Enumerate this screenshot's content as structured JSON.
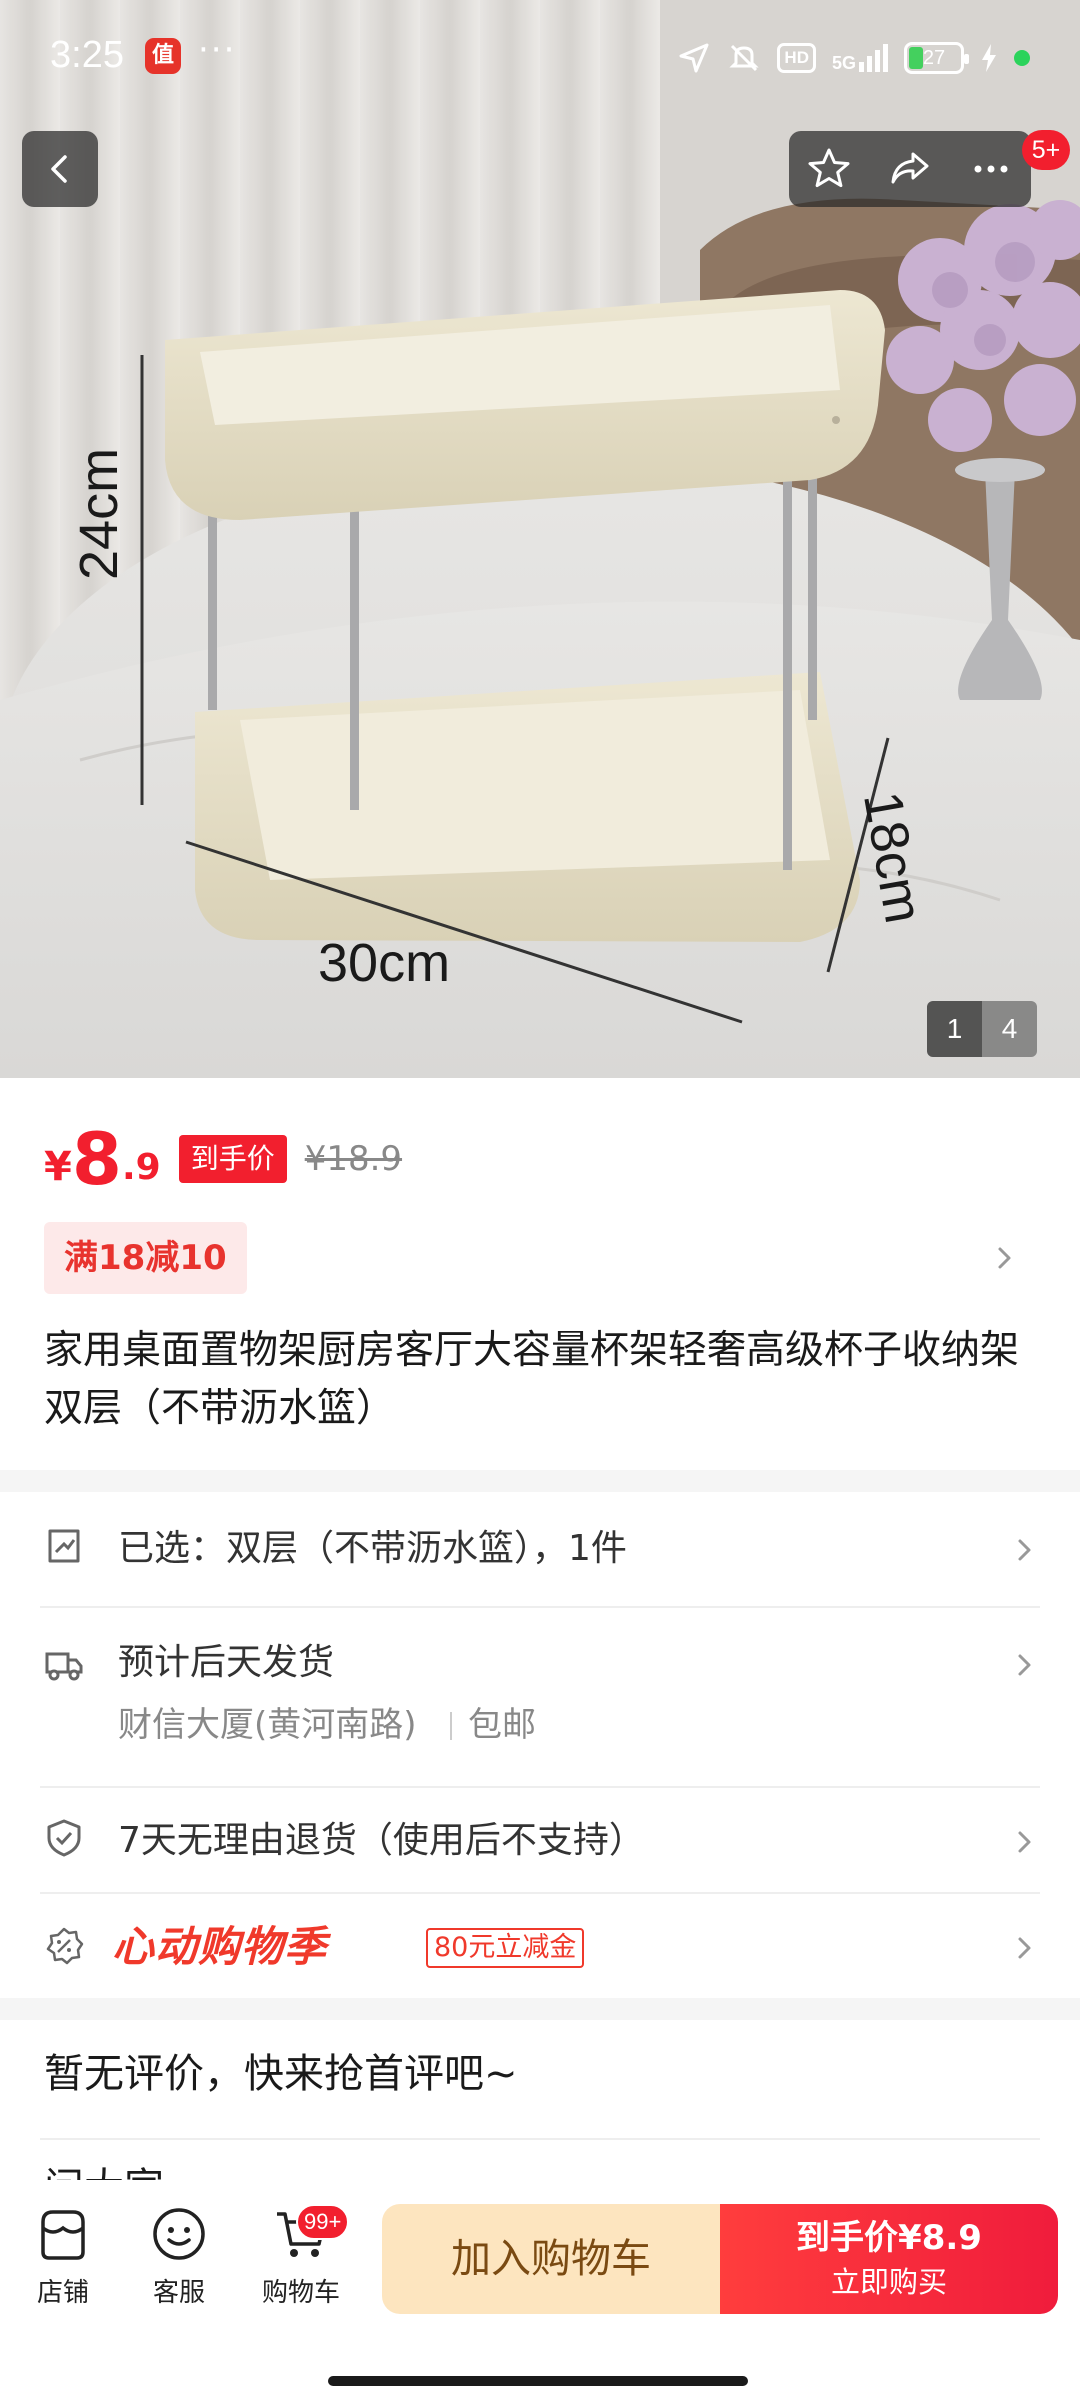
{
  "status_bar": {
    "time": "3:25",
    "app_badge": "值",
    "more_dots": "···",
    "hd": "HD",
    "network": "5G",
    "battery": "27"
  },
  "hero": {
    "dims": {
      "height": "24cm",
      "width": "30cm",
      "depth": "18cm"
    },
    "page_current": "1",
    "page_total": "4",
    "message_badge": "5+"
  },
  "price": {
    "currency": "¥",
    "integer": "8",
    "decimal": ".9",
    "tag": "到手价",
    "original": "¥18.9"
  },
  "coupon": {
    "label": "满18减10"
  },
  "product": {
    "title": "家用桌面置物架厨房客厅大容量杯架轻奢高级杯子收纳架 双层（不带沥水篮）"
  },
  "rows": {
    "selected": "已选：双层（不带沥水篮），1件",
    "shipping": "预计后天发货",
    "address": "财信大厦(黄河南路)",
    "free_shipping": "包邮",
    "returns": "7天无理由退货（使用后不支持）",
    "promo_brand": "心动购物季",
    "promo_tag": "80元立减金"
  },
  "reviews": {
    "title": "暂无评价，快来抢首评吧~"
  },
  "ask": {
    "title": "问大家"
  },
  "bottom_bar": {
    "store": "店铺",
    "service": "客服",
    "cart": "购物车",
    "cart_badge": "99+",
    "add_to_cart": "加入购物车",
    "buy_line1": "到手价¥8.9",
    "buy_line2": "立即购买"
  },
  "colors": {
    "accent": "#f21f2e",
    "coupon_bg": "#fde9e9",
    "cart_btn": "#fde5bf"
  }
}
